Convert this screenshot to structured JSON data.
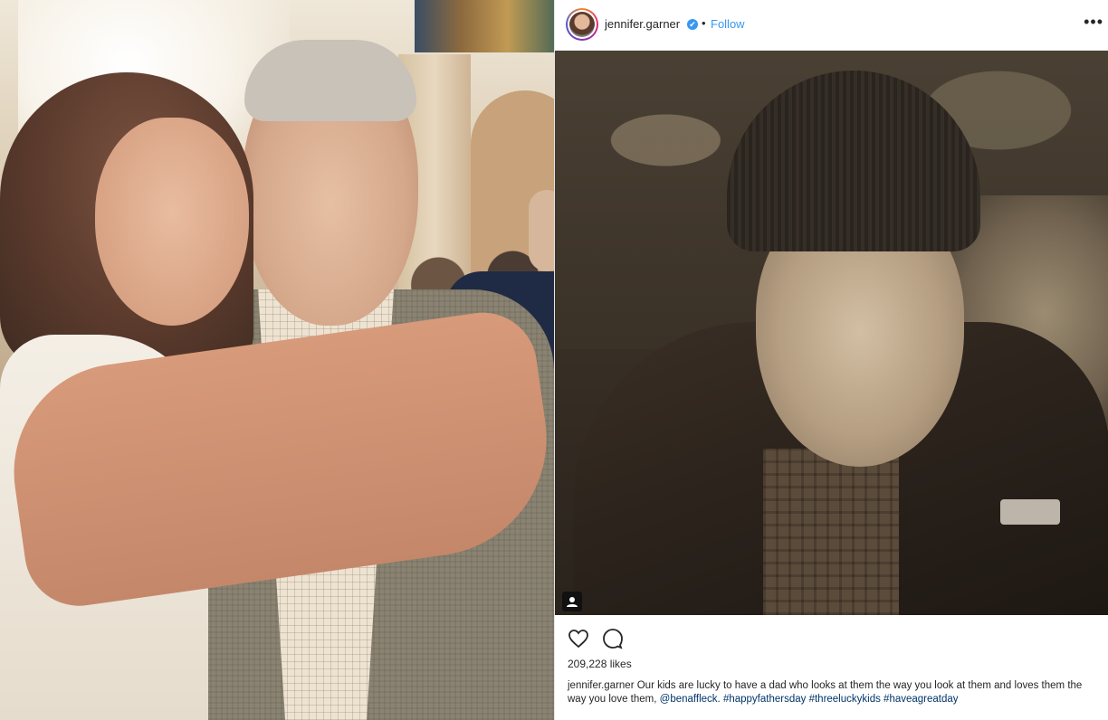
{
  "post": {
    "username": "jennifer.garner",
    "verified_glyph": "✔",
    "separator": "•",
    "follow_label": "Follow",
    "more_glyph": "•••",
    "likes": "209,228 likes",
    "caption": {
      "username": "jennifer.garner",
      "text": "Our kids are lucky to have a dad who looks at them the way you look at them and loves them the way you love them, ",
      "mention": "@benaffleck.",
      "hashtags": [
        "#happyfathersday",
        "#threeluckykids",
        "#haveagreatday"
      ]
    },
    "icons": {
      "like": "heart-icon",
      "comment": "comment-icon",
      "tagged": "user-tag-icon",
      "more": "more-options-icon",
      "verified": "verified-badge-icon"
    }
  },
  "colors": {
    "link_blue": "#3897f0",
    "text": "#262626",
    "hashtag": "#003569"
  }
}
